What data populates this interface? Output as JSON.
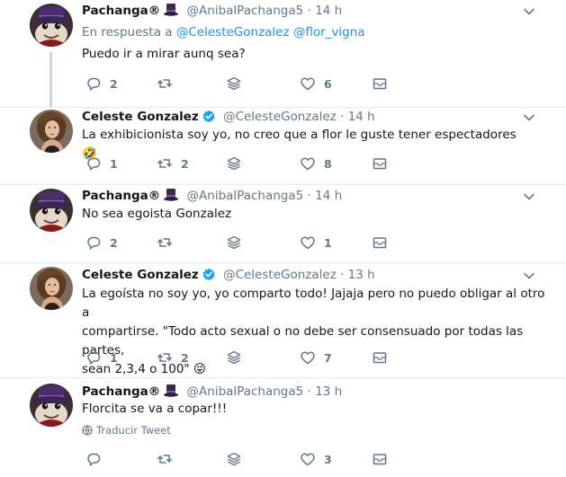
{
  "tweets": [
    {
      "name": "Pachanga®",
      "handle": "@AnibalPachanga5",
      "sep": "·",
      "time": "14 h",
      "reply_prefix": "En respuesta a",
      "reply_mentions": [
        "@CelesteGonzalez",
        "@flor_vigna"
      ],
      "text": "Puedo ir a mirar aunq sea?",
      "replies": "2",
      "retweets": "",
      "likes": "6"
    },
    {
      "name": "Celeste Gonzalez",
      "handle": "@CelesteGonzalez",
      "sep": "·",
      "time": "14 h",
      "text": "La exhibicionista soy yo, no creo que a flor le guste tener espectadores 🤣",
      "replies": "1",
      "retweets": "2",
      "likes": "8"
    },
    {
      "name": "Pachanga®",
      "handle": "@AnibalPachanga5",
      "sep": "·",
      "time": "14 h",
      "text": "No sea egoista Gonzalez",
      "replies": "2",
      "retweets": "",
      "likes": "1"
    },
    {
      "name": "Celeste Gonzalez",
      "handle": "@CelesteGonzalez",
      "sep": "·",
      "time": "13 h",
      "text_lines": [
        "La egoísta no soy yo, yo comparto todo! Jajaja pero no puedo obligar al otro a",
        "compartirse. \"Todo acto sexual o no debe ser consensuado por todas las partes,",
        "sean 2,3,4 o 100\" 😝"
      ],
      "replies": "1",
      "retweets": "2",
      "likes": "7"
    },
    {
      "name": "Pachanga®",
      "handle": "@AnibalPachanga5",
      "sep": "·",
      "time": "13 h",
      "text": "Florcita se va a copar!!!",
      "translate": "Traducir Tweet",
      "replies": "",
      "retweets": "",
      "likes": "3"
    }
  ],
  "colors": {
    "text": "#14171a",
    "secondary": "#657786",
    "link": "#1b95e0",
    "verified": "#1da1f2",
    "divider": "#e6ecf0",
    "thread_line": "#ccd6dd"
  },
  "icons": [
    "reply-icon",
    "retweet-icon",
    "share-layers-icon",
    "heart-icon",
    "direct-message-icon",
    "caret-down-icon",
    "verified-badge-icon",
    "top-hat-emoji",
    "globe-translate-icon"
  ]
}
